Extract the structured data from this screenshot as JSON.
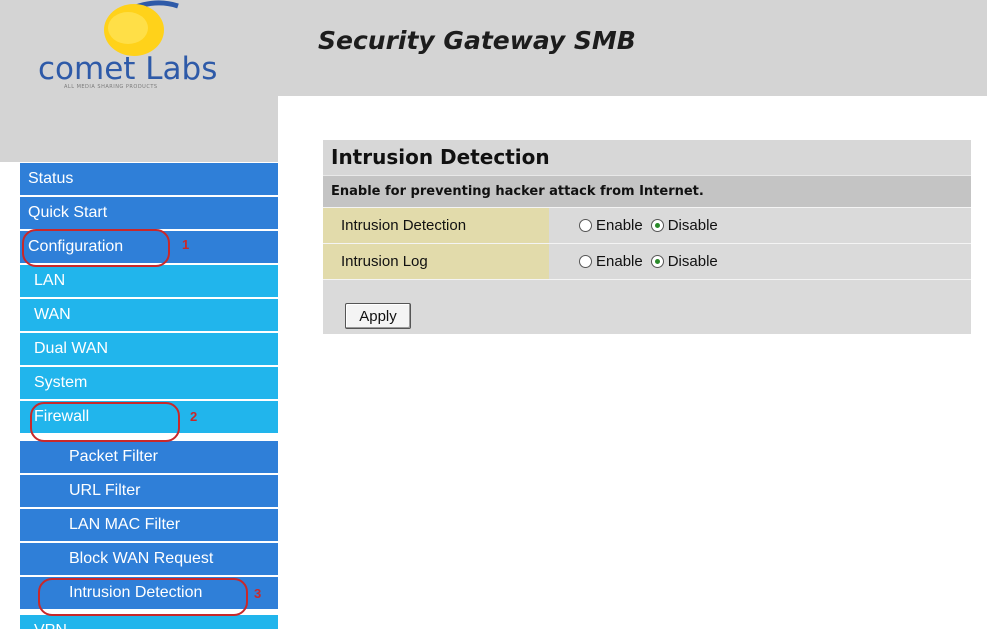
{
  "brand": {
    "logo_text": "comet Labs",
    "logo_tagline": "ALL MEDIA SHARING PRODUCTS"
  },
  "header": {
    "product_title": "Security Gateway SMB"
  },
  "sidebar": {
    "items": [
      {
        "label": "Status",
        "level": 0
      },
      {
        "label": "Quick Start",
        "level": 0
      },
      {
        "label": "Configuration",
        "level": 0
      },
      {
        "label": "LAN",
        "level": 1
      },
      {
        "label": "WAN",
        "level": 1
      },
      {
        "label": "Dual WAN",
        "level": 1
      },
      {
        "label": "System",
        "level": 1
      },
      {
        "label": "Firewall",
        "level": 1
      },
      {
        "label": "Packet Filter",
        "level": 2
      },
      {
        "label": "URL Filter",
        "level": 2
      },
      {
        "label": "LAN MAC Filter",
        "level": 2
      },
      {
        "label": "Block WAN Request",
        "level": 2
      },
      {
        "label": "Intrusion Detection",
        "level": 2
      },
      {
        "label": "VPN",
        "level": 1
      }
    ]
  },
  "annotations": [
    "1",
    "2",
    "3"
  ],
  "main": {
    "title": "Intrusion Detection",
    "subtitle": "Enable for preventing hacker attack from Internet.",
    "rows": [
      {
        "label": "Intrusion Detection",
        "enable_label": "Enable",
        "disable_label": "Disable",
        "selected": "Disable"
      },
      {
        "label": "Intrusion Log",
        "enable_label": "Enable",
        "disable_label": "Disable",
        "selected": "Disable"
      }
    ],
    "apply_label": "Apply"
  },
  "colors": {
    "nav_dark": "#2f7fd8",
    "nav_light": "#21b5ec",
    "annotation_red": "#c8282a",
    "row_label_bg": "#e2dbab"
  }
}
